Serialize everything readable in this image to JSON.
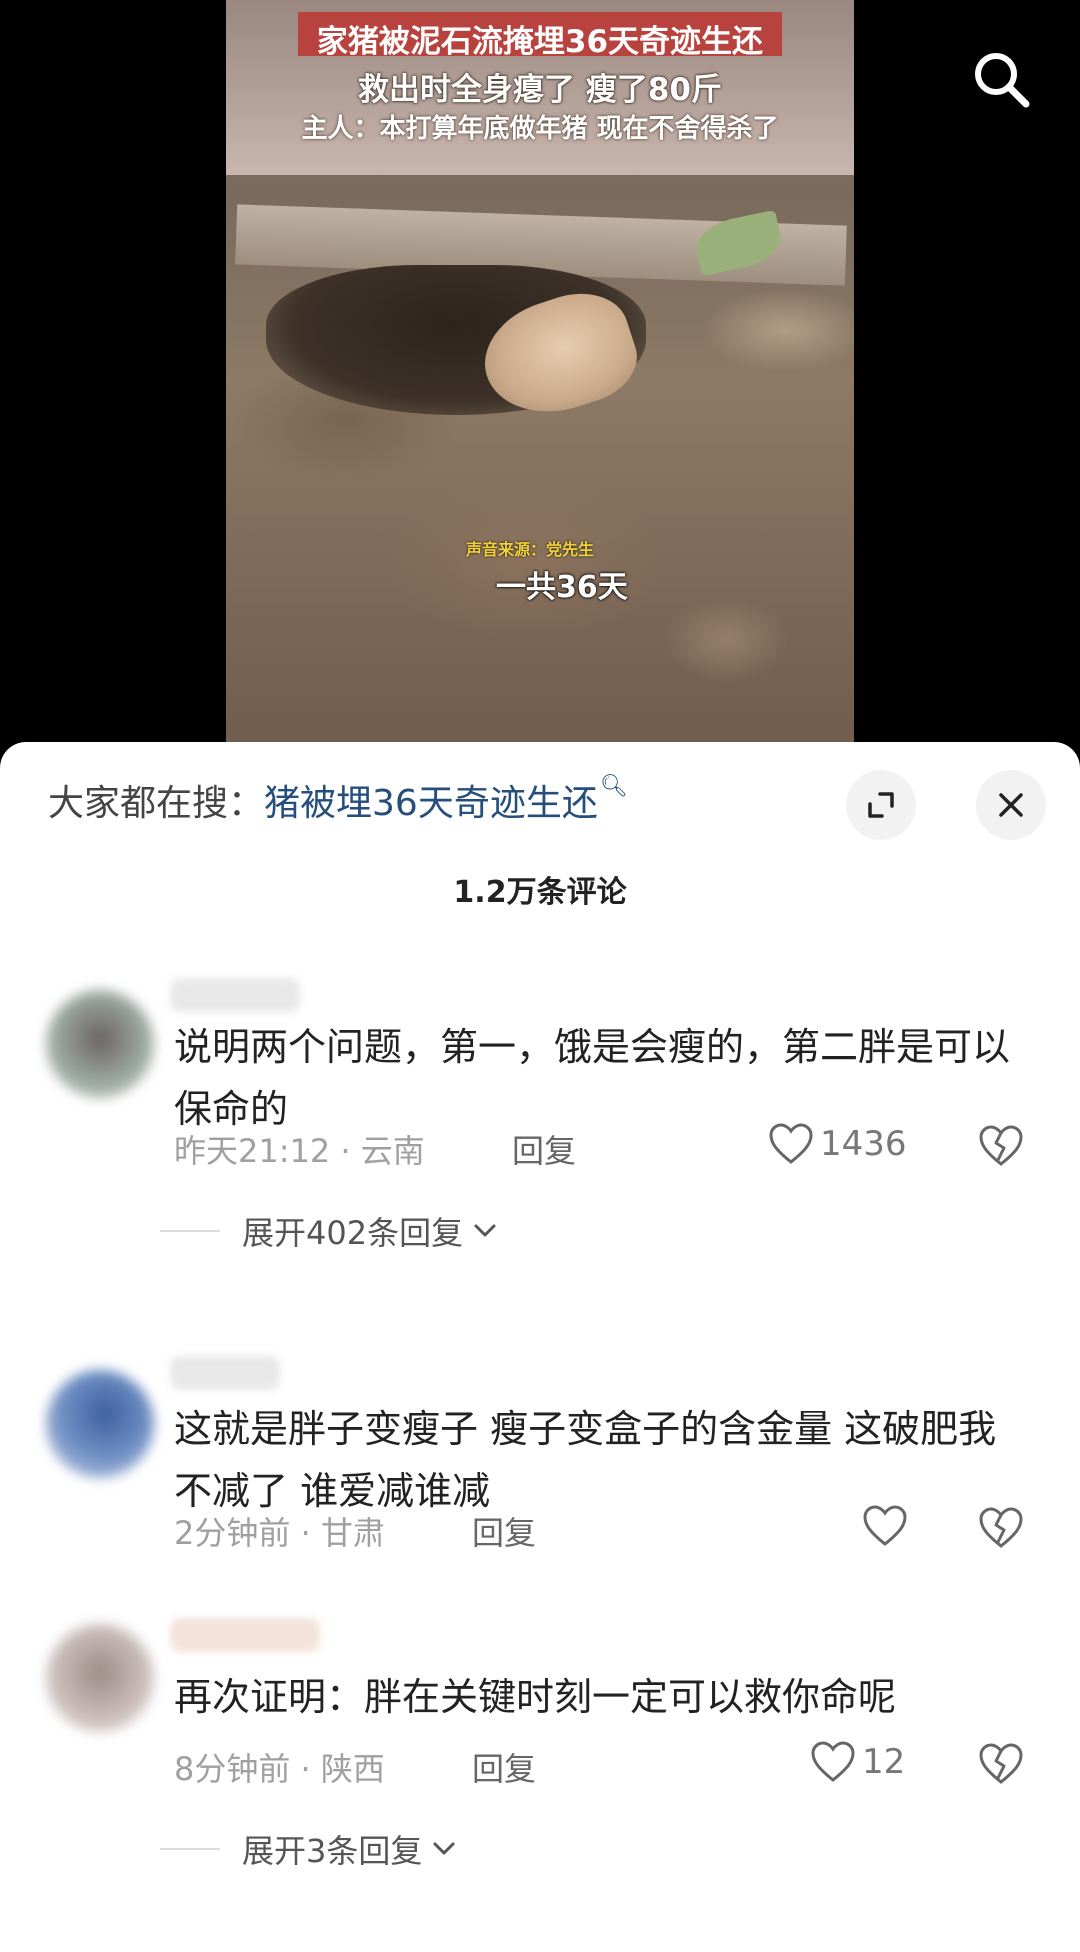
{
  "video": {
    "title_line1": "家猪被泥石流掩埋36天奇迹生还",
    "title_line2": "救出时全身瘪了  瘦了80斤",
    "title_line3": "主人：本打算年底做年猪  现在不舍得杀了",
    "sound_source": "声音来源：党先生",
    "subtitle": "一共36天",
    "search_icon": "search-icon"
  },
  "sheet": {
    "search_prefix": "大家都在搜：",
    "search_term": "猪被埋36天奇迹生还",
    "comment_count": "1.2万条评论",
    "expand_icon": "expand-icon",
    "close_icon": "close-icon"
  },
  "comments": [
    {
      "text": "说明两个问题，第一，饿是会瘦的，第二胖是可以保命的",
      "time_location": "昨天21:12 · 云南",
      "reply": "回复",
      "likes": "1436",
      "expand_replies": "展开402条回复"
    },
    {
      "text": "这就是胖子变瘦子 瘦子变盒子的含金量 这破肥我不减了 谁爱减谁减",
      "time_location": "2分钟前 · 甘肃",
      "reply": "回复",
      "likes": ""
    },
    {
      "text": "再次证明：胖在关键时刻一定可以救你命呢",
      "time_location": "8分钟前 · 陕西",
      "reply": "回复",
      "likes": "12",
      "expand_replies": "展开3条回复"
    }
  ],
  "colors": {
    "search_term": "#254e7c",
    "caption_bg": "#b8433e",
    "sound_source": "#f4d23a"
  }
}
